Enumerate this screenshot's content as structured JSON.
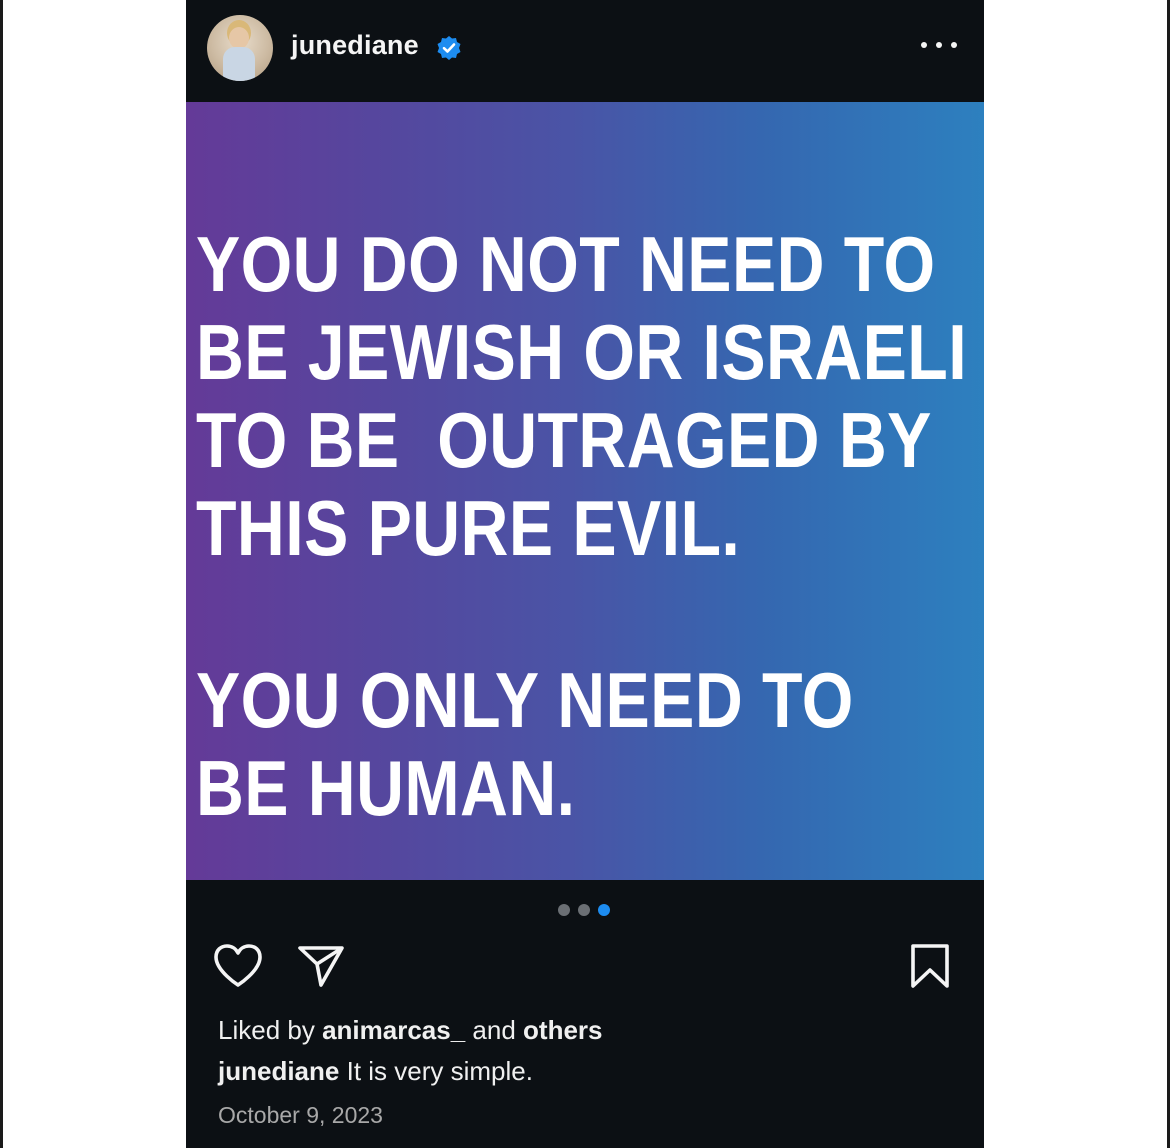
{
  "post": {
    "username": "junediane",
    "verified": true,
    "image_text": {
      "line1": "YOU DO NOT NEED TO",
      "line2": "BE JEWISH OR ISRAELI",
      "line3": "TO BE  OUTRAGED BY",
      "line4": "THIS PURE EVIL.",
      "line5": "YOU ONLY NEED TO",
      "line6": "BE HUMAN."
    },
    "carousel": {
      "total": 3,
      "active_index": 2
    },
    "likes": {
      "prefix": "Liked by",
      "user": "animarcas_",
      "middle": "and",
      "suffix": "others"
    },
    "caption": {
      "username": "junediane",
      "text": "It is very simple."
    },
    "date": "October 9, 2023"
  },
  "icons": {
    "avatar": "profile-avatar",
    "verified": "verified-badge-icon",
    "more": "more-options-icon",
    "like": "heart-icon",
    "share": "send-icon",
    "save": "bookmark-icon"
  },
  "colors": {
    "background": "#0c1014",
    "gradient_start": "#643a98",
    "gradient_end": "#2d80bf",
    "verified_blue": "#1d8cf0",
    "active_dot": "#1d8cf0",
    "inactive_dot": "#6b6f74",
    "date_gray": "#a8a8a8"
  }
}
